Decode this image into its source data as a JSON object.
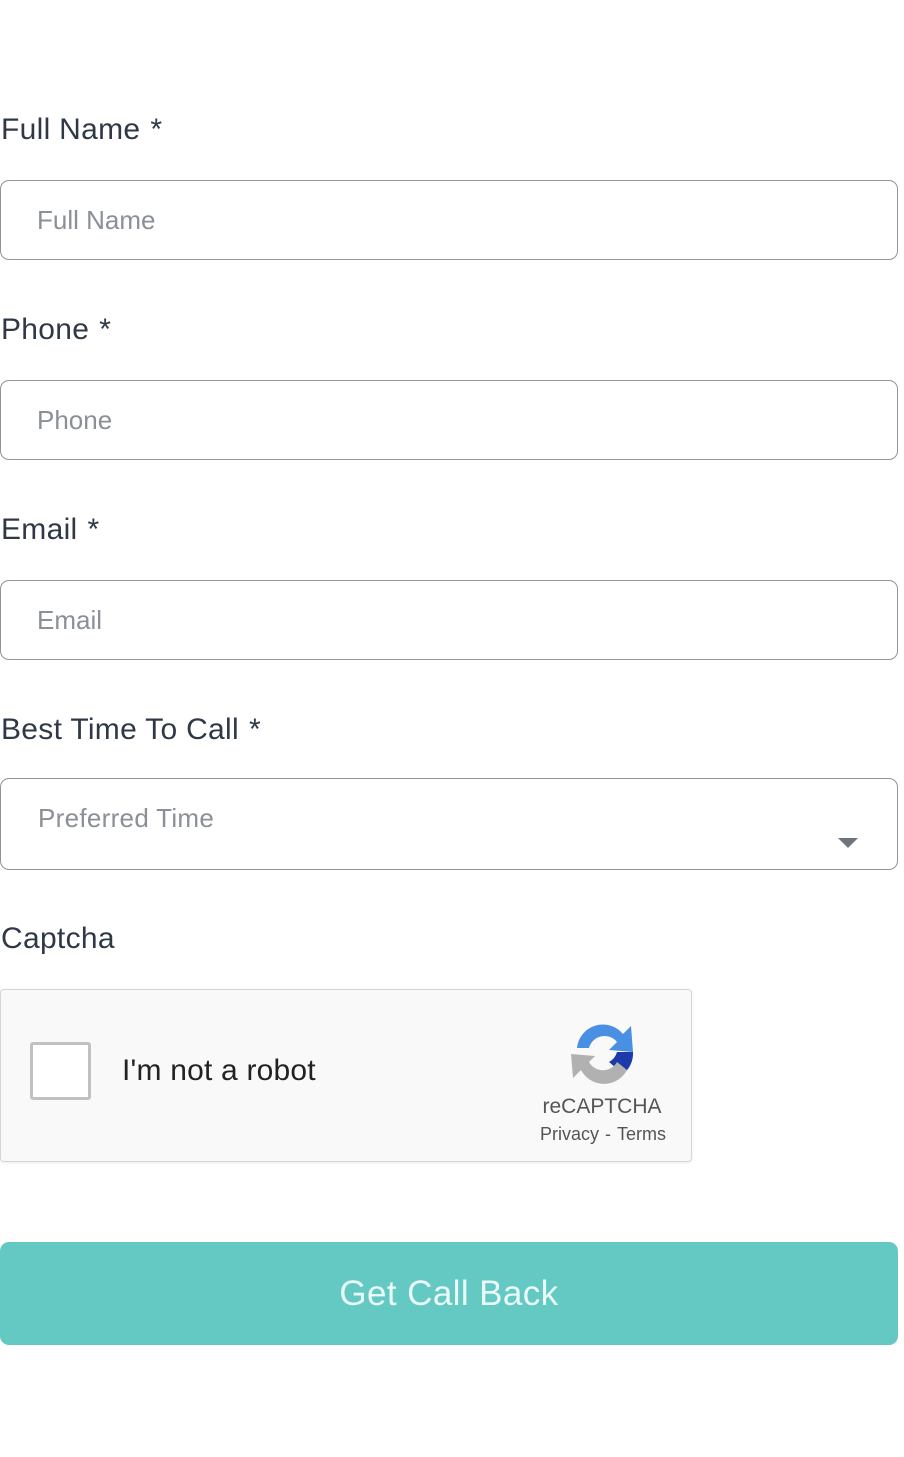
{
  "form": {
    "full_name": {
      "label": "Full Name",
      "required_mark": "*",
      "placeholder": "Full Name",
      "value": ""
    },
    "phone": {
      "label": "Phone",
      "required_mark": "*",
      "placeholder": "Phone",
      "value": ""
    },
    "email": {
      "label": "Email",
      "required_mark": "*",
      "placeholder": "Email",
      "value": ""
    },
    "best_time": {
      "label": "Best Time To Call",
      "required_mark": "*",
      "placeholder": "Preferred Time",
      "icon": "chevron-down-icon"
    },
    "captcha": {
      "label": "Captcha",
      "checkbox_text": "I'm not a robot",
      "checked": false,
      "brand": "reCAPTCHA",
      "privacy_link": "Privacy",
      "separator": "-",
      "terms_link": "Terms",
      "icon": "recaptcha-logo-icon"
    },
    "submit_label": "Get Call Back"
  },
  "colors": {
    "accent": "#65c9c3",
    "label_text": "#2f3945",
    "placeholder_text": "#8a9096",
    "field_border": "#8e959c",
    "captcha_background": "#f9f9f9",
    "recaptcha_blue": "#1c3aa9",
    "recaptcha_light_blue": "#4a90e2",
    "recaptcha_grey": "#b1b1b1"
  }
}
